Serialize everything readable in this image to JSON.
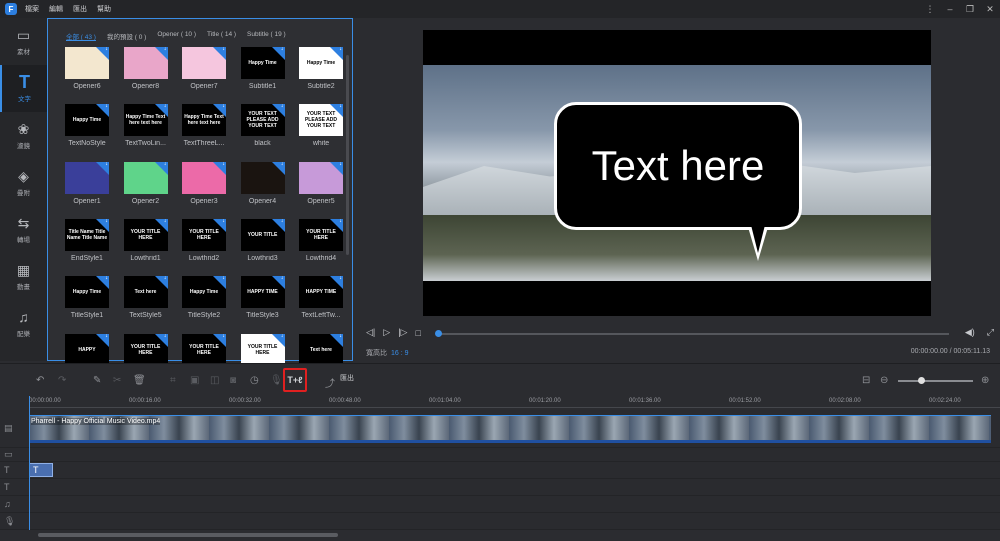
{
  "app": {
    "logo": "F",
    "menu": [
      "檔案",
      "編輯",
      "匯出",
      "幫助"
    ]
  },
  "window_controls": [
    "⋮",
    "–",
    "❐",
    "✕"
  ],
  "sidebar": [
    {
      "label": "素材",
      "icon": "media-icon"
    },
    {
      "label": "文字",
      "icon": "text-icon"
    },
    {
      "label": "濾鏡",
      "icon": "filter-icon"
    },
    {
      "label": "疊附",
      "icon": "overlay-icon"
    },
    {
      "label": "轉場",
      "icon": "transition-icon"
    },
    {
      "label": "動畫",
      "icon": "animation-icon"
    },
    {
      "label": "配樂",
      "icon": "music-icon"
    }
  ],
  "tabs": [
    "全部 ( 43 )",
    "我的預設 ( 0 )",
    "Opener ( 10 )",
    "Title ( 14 )",
    "Subtitle ( 19 )"
  ],
  "tiles": [
    {
      "name": "Opener6",
      "text": "",
      "bg": "#f3e7cf"
    },
    {
      "name": "Opener8",
      "text": "",
      "bg": "#e9a6c9"
    },
    {
      "name": "Opener7",
      "text": "",
      "bg": "#f5c6de"
    },
    {
      "name": "Subtitle1",
      "text": "Happy Time",
      "bg": "#000000"
    },
    {
      "name": "Subtitle2",
      "text": "Happy Time",
      "bg": "#ffffff"
    },
    {
      "name": "TextNoStyle",
      "text": "Happy Time",
      "bg": "#000000"
    },
    {
      "name": "TextTwoLin...",
      "text": "Happy Time Text here text here",
      "bg": "#000000"
    },
    {
      "name": "TextThreeL...",
      "text": "Happy Time Text here text here",
      "bg": "#000000"
    },
    {
      "name": "black",
      "text": "YOUR TEXT PLEASE ADD YOUR TEXT",
      "bg": "#000000"
    },
    {
      "name": "white",
      "text": "YOUR TEXT PLEASE ADD YOUR TEXT",
      "bg": "#ffffff"
    },
    {
      "name": "Opener1",
      "text": "",
      "bg": "#3a3f9a"
    },
    {
      "name": "Opener2",
      "text": "",
      "bg": "#5fd48a"
    },
    {
      "name": "Opener3",
      "text": "",
      "bg": "#ec6aa8"
    },
    {
      "name": "Opener4",
      "text": "",
      "bg": "#1a1410"
    },
    {
      "name": "Opener5",
      "text": "",
      "bg": "#c79ad9"
    },
    {
      "name": "EndStyle1",
      "text": "Title Name Title Name Title Name",
      "bg": "#000000"
    },
    {
      "name": "Lowthrid1",
      "text": "YOUR TITLE HERE",
      "bg": "#000000"
    },
    {
      "name": "Lowthrid2",
      "text": "YOUR TITLE HERE",
      "bg": "#000000"
    },
    {
      "name": "Lowthrid3",
      "text": "YOUR TITLE",
      "bg": "#000000"
    },
    {
      "name": "Lowthrid4",
      "text": "YOUR TITLE HERE",
      "bg": "#000000"
    },
    {
      "name": "TitleStyle1",
      "text": "Happy Time",
      "bg": "#000000"
    },
    {
      "name": "TextStyle5",
      "text": "Text here",
      "bg": "#000000"
    },
    {
      "name": "TitleStyle2",
      "text": "Happy Time",
      "bg": "#000000"
    },
    {
      "name": "TitleStyle3",
      "text": "HAPPY TIME",
      "bg": "#000000"
    },
    {
      "name": "TextLeftTw...",
      "text": "HAPPY TIME",
      "bg": "#000000"
    },
    {
      "name": "",
      "text": "HAPPY",
      "bg": "#000000"
    },
    {
      "name": "",
      "text": "YOUR TITLE HERE",
      "bg": "#000000"
    },
    {
      "name": "",
      "text": "YOUR TITLE HERE",
      "bg": "#000000"
    },
    {
      "name": "",
      "text": "YOUR TITLE HERE",
      "bg": "#ffffff"
    },
    {
      "name": "",
      "text": "Text here",
      "bg": "#000000"
    }
  ],
  "preview": {
    "overlay_text": "Text here",
    "ratio_label": "寬高比",
    "ratio_value": "16 : 9",
    "time": "00:00:00.00 / 00:05:11.13",
    "progress": 0.0
  },
  "toolbar": {
    "text_tool_label": "T+ℓ",
    "export_label": "匯出",
    "zoom_level": 0.3
  },
  "ruler": [
    "00:00:00.00",
    "00:00:16.00",
    "00:00:32.00",
    "00:00:48.00",
    "00:01:04.00",
    "00:01:20.00",
    "00:01:36.00",
    "00:01:52.00",
    "00:02:08.00",
    "00:02:24.00"
  ],
  "video_clip_title": "Pharrell - Happy Official Music Video.mp4",
  "text_clip_label": "T"
}
